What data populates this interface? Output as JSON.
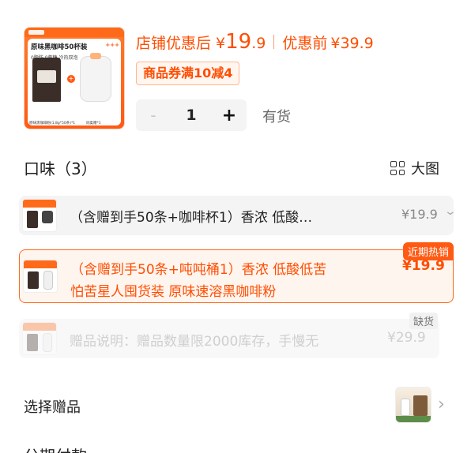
{
  "product": {
    "thumb_title": "原味黑咖啡50杯装",
    "thumb_sub": "0脂肪  0蔗糖  冷热双泡",
    "thumb_plus": "+++",
    "thumb_cap_left": "原味黑咖啡粉(1.8g*50条)*1",
    "thumb_cap_right": "同类赠*1"
  },
  "price": {
    "shop_label": "店铺优惠后",
    "yen": "¥",
    "shop_big": "19",
    "shop_small": ".9",
    "before_label": "优惠前",
    "before_price": "¥39.9"
  },
  "coupon": {
    "label": "商品券满10减4"
  },
  "stepper": {
    "minus": "-",
    "qty": "1",
    "plus": "+",
    "stock": "有货"
  },
  "flavor": {
    "title": "口味（3）",
    "bigview_label": "大图",
    "options": [
      {
        "text": "（含赠到手50条+咖啡杯1）香浓 低酸…",
        "price": "¥19.9"
      },
      {
        "text_line1": "（含赠到手50条+吨吨桶1）香浓 低酸低苦",
        "text_line2": "怕苦星人囤货装 原味速溶黑咖啡粉",
        "price": "¥19.9",
        "badge": "近期热销"
      },
      {
        "text": "赠品说明：赠品数量限2000库存，手慢无",
        "price": "¥29.9",
        "badge": "缺货"
      }
    ]
  },
  "gift": {
    "label": "选择赠品"
  },
  "next_section": {
    "title": "分期付款"
  },
  "colors": {
    "accent": "#ff4d00",
    "accent_bg": "#fff5ef"
  }
}
